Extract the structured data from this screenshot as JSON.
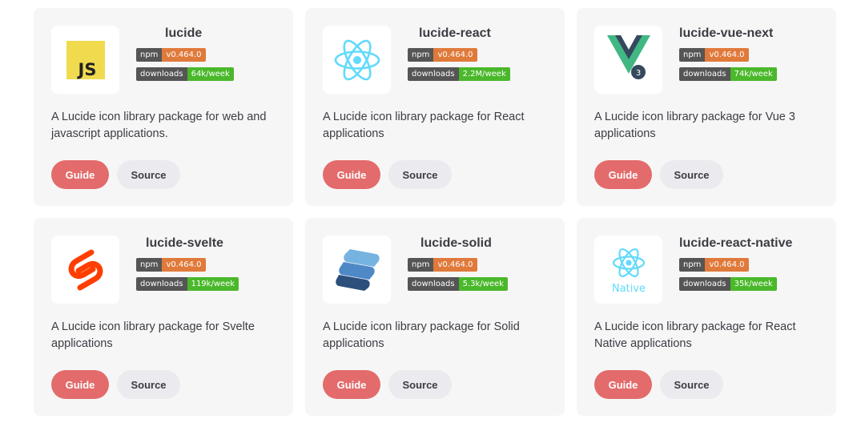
{
  "colors": {
    "card_bg": "#f6f6f7",
    "guide_btn": "#e36b6b",
    "source_btn": "#ebebef",
    "npm_badge": "#e07a3b",
    "downloads_badge": "#4ab82a",
    "badge_label": "#555555"
  },
  "packages": [
    {
      "name": "lucide",
      "icon": "javascript-logo-icon",
      "npm_label": "npm",
      "version": "v0.464.0",
      "downloads_label": "downloads",
      "downloads": "64k/week",
      "description": "A Lucide icon library package for web and javascript applications.",
      "guide": "Guide",
      "source": "Source"
    },
    {
      "name": "lucide-react",
      "icon": "react-logo-icon",
      "npm_label": "npm",
      "version": "v0.464.0",
      "downloads_label": "downloads",
      "downloads": "2.2M/week",
      "description": "A Lucide icon library package for React applications",
      "guide": "Guide",
      "source": "Source"
    },
    {
      "name": "lucide-vue-next",
      "icon": "vue-logo-icon",
      "badge_text": "3",
      "npm_label": "npm",
      "version": "v0.464.0",
      "downloads_label": "downloads",
      "downloads": "74k/week",
      "description": "A Lucide icon library package for Vue 3 applications",
      "guide": "Guide",
      "source": "Source"
    },
    {
      "name": "lucide-svelte",
      "icon": "svelte-logo-icon",
      "npm_label": "npm",
      "version": "v0.464.0",
      "downloads_label": "downloads",
      "downloads": "119k/week",
      "description": "A Lucide icon library package for Svelte applications",
      "guide": "Guide",
      "source": "Source"
    },
    {
      "name": "lucide-solid",
      "icon": "solid-logo-icon",
      "npm_label": "npm",
      "version": "v0.464.0",
      "downloads_label": "downloads",
      "downloads": "5.3k/week",
      "description": "A Lucide icon library package for Solid applications",
      "guide": "Guide",
      "source": "Source"
    },
    {
      "name": "lucide-react-native",
      "icon": "react-native-logo-icon",
      "logo_text": "Native",
      "npm_label": "npm",
      "version": "v0.464.0",
      "downloads_label": "downloads",
      "downloads": "35k/week",
      "description": "A Lucide icon library package for React Native applications",
      "guide": "Guide",
      "source": "Source"
    }
  ]
}
